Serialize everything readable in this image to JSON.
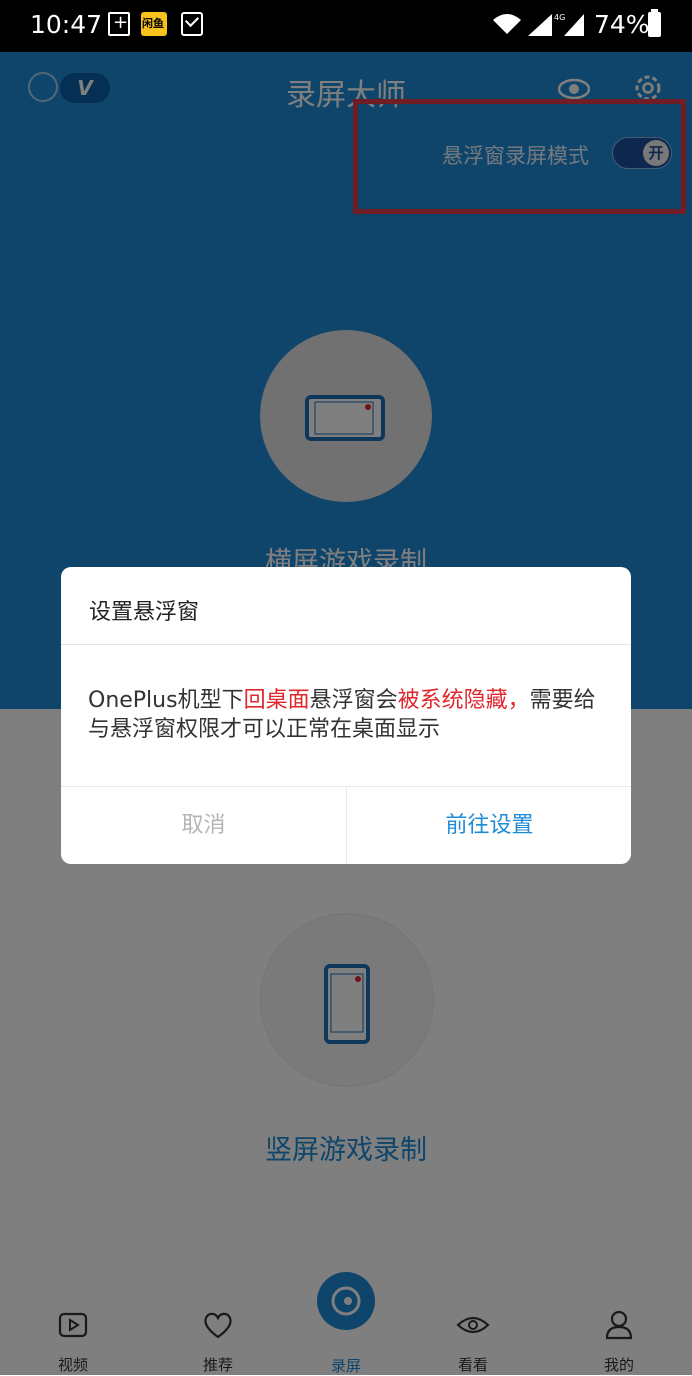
{
  "status_bar": {
    "time": "10:47",
    "battery_pct": "74%",
    "app_badge": "闲鱼",
    "network_label": "4G"
  },
  "app": {
    "title": "录屏大师",
    "vip_badge": "V"
  },
  "float_mode": {
    "label": "悬浮窗录屏模式",
    "toggle_text": "开",
    "enabled": true
  },
  "record_options": {
    "landscape_label": "横屏游戏录制",
    "portrait_label": "竖屏游戏录制"
  },
  "bottom_nav": [
    {
      "label": "视频",
      "icon": "video-icon"
    },
    {
      "label": "推荐",
      "icon": "heart-icon"
    },
    {
      "label": "录屏",
      "icon": "record-icon"
    },
    {
      "label": "看看",
      "icon": "eye-icon"
    },
    {
      "label": "我的",
      "icon": "user-icon"
    }
  ],
  "dialog": {
    "title": "设置悬浮窗",
    "body": {
      "part1": "OnePlus机型下",
      "part2_red": "回桌面",
      "part3": "悬浮窗会",
      "part4_red": "被系统隐藏，",
      "part5": "需要给与悬浮窗权限才可以正常在桌面显示"
    },
    "cancel_label": "取消",
    "confirm_label": "前往设置"
  },
  "colors": {
    "primary": "#1f8bd6",
    "highlight": "#e23a4a",
    "emphasis": "#e0262c"
  }
}
